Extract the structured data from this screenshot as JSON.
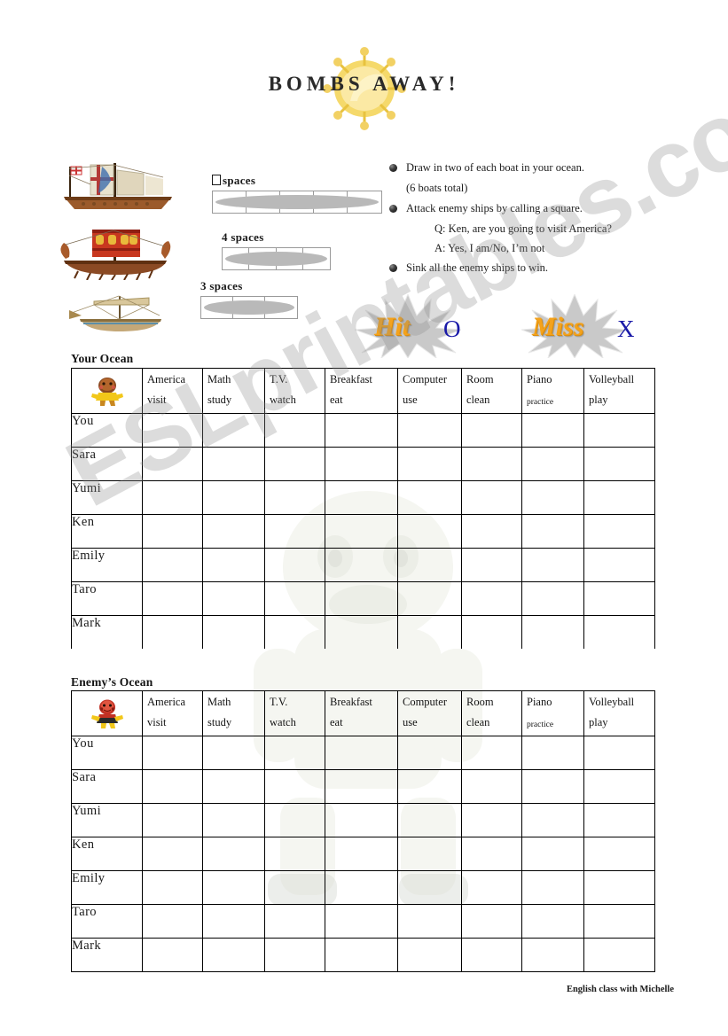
{
  "document": {
    "title": "BOMBS AWAY!",
    "footer": "English class with Michelle",
    "watermark": "ESLprintables.com"
  },
  "ships": [
    {
      "label_prefix": "",
      "label": "spaces",
      "spaces": 5,
      "missing_glyph": true
    },
    {
      "label_prefix": "4",
      "label": "spaces",
      "spaces": 4,
      "missing_glyph": false
    },
    {
      "label_prefix": "3",
      "label": "spaces",
      "spaces": 3,
      "missing_glyph": false
    }
  ],
  "instructions": [
    {
      "text": "Draw in two of each boat in your ocean.",
      "bullet": true,
      "indent": "none"
    },
    {
      "text": "(6 boats total)",
      "bullet": false,
      "indent": "none"
    },
    {
      "text": "Attack enemy ships by calling a square.",
      "bullet": true,
      "indent": "none"
    },
    {
      "text": "Q: Ken, are you going to visit America?",
      "bullet": false,
      "indent": "qa"
    },
    {
      "text": "A: Yes, I am/No, I’m not",
      "bullet": false,
      "indent": "qa"
    },
    {
      "text": "Sink all the enemy ships to win.",
      "bullet": true,
      "indent": "none"
    }
  ],
  "legend": {
    "hit_word": "Hit",
    "hit_mark": "O",
    "miss_word": "Miss",
    "miss_mark": "X",
    "word_color": "#F4A21B",
    "mark_color": "#1a1aa8"
  },
  "columns": [
    {
      "topic": "America",
      "verb": "visit",
      "verb_small": false
    },
    {
      "topic": "Math",
      "verb": "study",
      "verb_small": false
    },
    {
      "topic": "T.V.",
      "verb": "watch",
      "verb_small": false
    },
    {
      "topic": "Breakfast",
      "verb": "eat",
      "verb_small": false
    },
    {
      "topic": "Computer",
      "verb": "use",
      "verb_small": false
    },
    {
      "topic": "Room",
      "verb": "clean",
      "verb_small": false
    },
    {
      "topic": "Piano",
      "verb": "practice",
      "verb_small": true
    },
    {
      "topic": "Volleyball",
      "verb": "play",
      "verb_small": false
    }
  ],
  "rows": [
    "You",
    "Sara",
    "Yumi",
    "Ken",
    "Emily",
    "Taro",
    "Mark"
  ],
  "sections": [
    {
      "heading": "Your Ocean",
      "mascot": "yellow-mascot-icon"
    },
    {
      "heading": "Enemy’s Ocean",
      "mascot": "red-mascot-icon"
    }
  ]
}
